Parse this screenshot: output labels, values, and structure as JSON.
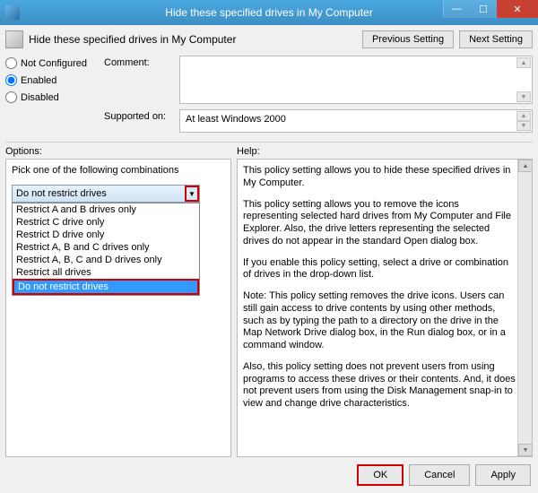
{
  "window": {
    "title": "Hide these specified drives in My Computer",
    "header_title": "Hide these specified drives in My Computer"
  },
  "nav": {
    "previous": "Previous Setting",
    "next": "Next Setting"
  },
  "state": {
    "not_configured": "Not Configured",
    "enabled": "Enabled",
    "disabled": "Disabled"
  },
  "form": {
    "comment_label": "Comment:",
    "supported_label": "Supported on:",
    "supported_value": "At least Windows 2000"
  },
  "labels": {
    "options": "Options:",
    "help": "Help:"
  },
  "options": {
    "prompt": "Pick one of the following combinations",
    "selected": "Do not restrict drives",
    "items": [
      "Restrict A and B drives only",
      "Restrict C drive only",
      "Restrict D drive only",
      "Restrict A, B and C drives only",
      "Restrict A, B, C and D drives only",
      "Restrict all drives",
      "Do not restrict drives"
    ]
  },
  "help": {
    "p1": "This policy setting allows you to hide these specified drives in My Computer.",
    "p2": "This policy setting allows you to remove the icons representing selected hard drives from My Computer and File Explorer. Also, the drive letters representing the selected drives do not appear in the standard Open dialog box.",
    "p3": "If you enable this policy setting, select a drive or combination of drives in the drop-down list.",
    "p4": "Note: This policy setting removes the drive icons. Users can still gain access to drive contents by using other methods, such as by typing the path to a directory on the drive in the Map Network Drive dialog box, in the Run dialog box, or in a command window.",
    "p5": "Also, this policy setting does not prevent users from using programs to access these drives or their contents. And, it does not prevent users from using the Disk Management snap-in to view and change drive characteristics."
  },
  "footer": {
    "ok": "OK",
    "cancel": "Cancel",
    "apply": "Apply"
  }
}
